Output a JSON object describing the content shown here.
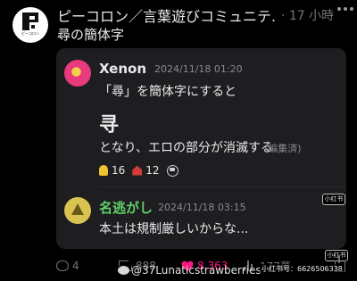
{
  "post": {
    "author": "ピーコロン／言葉遊びコミュニテ...",
    "meta": "· 17 小時",
    "text": "尋の簡体字",
    "avatar_caption": "ピーコロン"
  },
  "comments": [
    {
      "name": "Xenon ",
      "time": "2024/11/18 01:20",
      "line1": "「尋」を簡体字にすると",
      "kanji": "寻",
      "line2": "となり、エロの部分が消滅する",
      "edited": "(編集済)",
      "reactions": [
        {
          "icon": "bulb-icon",
          "count": "16"
        },
        {
          "icon": "house-icon",
          "count": "12"
        }
      ]
    },
    {
      "name": "名逃がし",
      "time": "2024/11/18 03:15",
      "text": "本土は規制厳しいからな..."
    }
  ],
  "actions": {
    "replies": "4",
    "reposts": "888",
    "likes": "8,363",
    "views": "177萬"
  },
  "watermark": {
    "handle": "@37Lunaticstrawberries",
    "xhs_label": "小红书",
    "xhs_id": "小红书号：6626506338"
  },
  "colors": {
    "background": "#000000",
    "card": "#1e1e20",
    "like": "#f91880",
    "name_green": "#5fd068",
    "muted": "#71767b"
  }
}
